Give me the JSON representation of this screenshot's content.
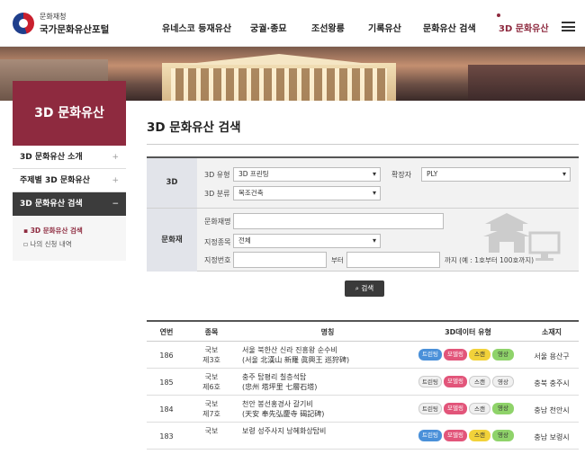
{
  "header": {
    "logo_sub": "문화재청",
    "logo_main": "국가문화유산포털",
    "nav": [
      "유네스코 등재유산",
      "궁궐·종묘",
      "조선왕릉",
      "기록유산",
      "문화유산 검색",
      "3D 문화유산"
    ],
    "active_nav": "3D 문화유산"
  },
  "sidebar": {
    "title": "3D 문화유산",
    "items": [
      {
        "label": "3D 문화유산 소개",
        "toggle": "+"
      },
      {
        "label": "주제별 3D 문화유산",
        "toggle": "+"
      },
      {
        "label": "3D 문화유산 검색",
        "toggle": "−"
      }
    ],
    "sub_items": [
      "3D 문화유산 검색",
      "나의 신청 내역"
    ]
  },
  "page": {
    "title": "3D 문화유산 검색"
  },
  "form": {
    "section_3d": "3D",
    "section_heritage": "문화재",
    "type_label": "3D 유형",
    "type_value": "3D 프린팅",
    "ext_label": "확장자",
    "ext_value": "PLY",
    "category_label": "3D 분류",
    "category_value": "목조건축",
    "name_label": "문화재명",
    "designation_label": "지정종목",
    "designation_value": "전체",
    "number_label": "지정번호",
    "from_text": "부터",
    "to_text": "까지 (예 : 1호부터 100호까지)",
    "search_label": "검색"
  },
  "table": {
    "headers": [
      "연번",
      "종목",
      "명칭",
      "3D데이터 유형",
      "소재지"
    ],
    "badge_labels": [
      "트린팅",
      "모델링",
      "스캔",
      "영상"
    ],
    "rows": [
      {
        "no": "186",
        "kind": [
          "국보",
          "제3호"
        ],
        "name": [
          "서울 북한산 신라 진흥왕 순수비",
          "(서울 北漢山 新羅 眞興王 巡狩碑)"
        ],
        "loc": "서울 용산구",
        "badges": [
          1,
          1,
          1,
          1
        ]
      },
      {
        "no": "185",
        "kind": [
          "국보",
          "제6호"
        ],
        "name": [
          "충주 탑평리 칠층석탑",
          "(忠州 塔坪里 七層石塔)"
        ],
        "loc": "충북 충주시",
        "badges": [
          0,
          1,
          0,
          0
        ]
      },
      {
        "no": "184",
        "kind": [
          "국보",
          "제7호"
        ],
        "name": [
          "천안 봉선홍경사 갈기비",
          "(天安 奉先弘慶寺 碣記碑)"
        ],
        "loc": "충남 천안시",
        "badges": [
          0,
          1,
          0,
          1
        ]
      },
      {
        "no": "183",
        "kind": [
          "국보",
          ""
        ],
        "name": [
          "보령 성주사지 낭혜화상탑비",
          ""
        ],
        "loc": "충남 보령시",
        "badges": [
          1,
          1,
          1,
          1
        ]
      }
    ]
  },
  "colors": {
    "brand": "#8e2a3f",
    "badge_print": "#4a90d9",
    "badge_model": "#e2557a",
    "badge_scan": "#f2d23a",
    "badge_video": "#8fd36a",
    "badge_off": "#f0f0f0"
  }
}
